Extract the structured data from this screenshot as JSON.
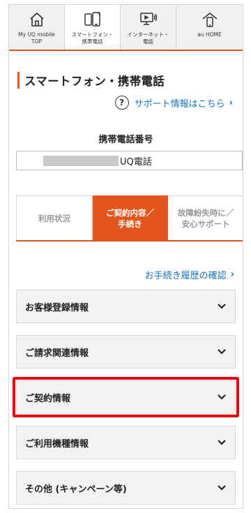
{
  "topnav": {
    "items": [
      {
        "label": "My UQ mobile\nTOP",
        "icon": "home-icon",
        "active": false
      },
      {
        "label": "スマートフォン・\n携帯電話",
        "icon": "smartphone-icon",
        "active": true
      },
      {
        "label": "インターネット・\n電話",
        "icon": "internet-icon",
        "active": false
      },
      {
        "label": "au HOME",
        "icon": "au-home-icon",
        "active": false
      }
    ]
  },
  "page": {
    "title": "スマートフォン・携帯電話",
    "support_link": "サポート情報はこちら",
    "phone_label": "携帯電話番号",
    "phone_name": "UQ電話"
  },
  "tabs": [
    {
      "label": "利用状況",
      "active": false
    },
    {
      "label": "ご契約内容／\n手続き",
      "active": true
    },
    {
      "label": "故障紛失時に／\n安心サポート",
      "active": false
    }
  ],
  "history_link": "お手続き履歴の確認",
  "accordion": [
    {
      "label": "お客様登録情報",
      "highlight": false
    },
    {
      "label": "ご請求関連情報",
      "highlight": false
    },
    {
      "label": "ご契約情報",
      "highlight": true
    },
    {
      "label": "ご利用機種情報",
      "highlight": false
    },
    {
      "label": "その他 (キャンペーン等)",
      "highlight": false
    }
  ],
  "colors": {
    "accent": "#e3561b",
    "link": "#1a73b8",
    "highlight": "#e8000d"
  }
}
